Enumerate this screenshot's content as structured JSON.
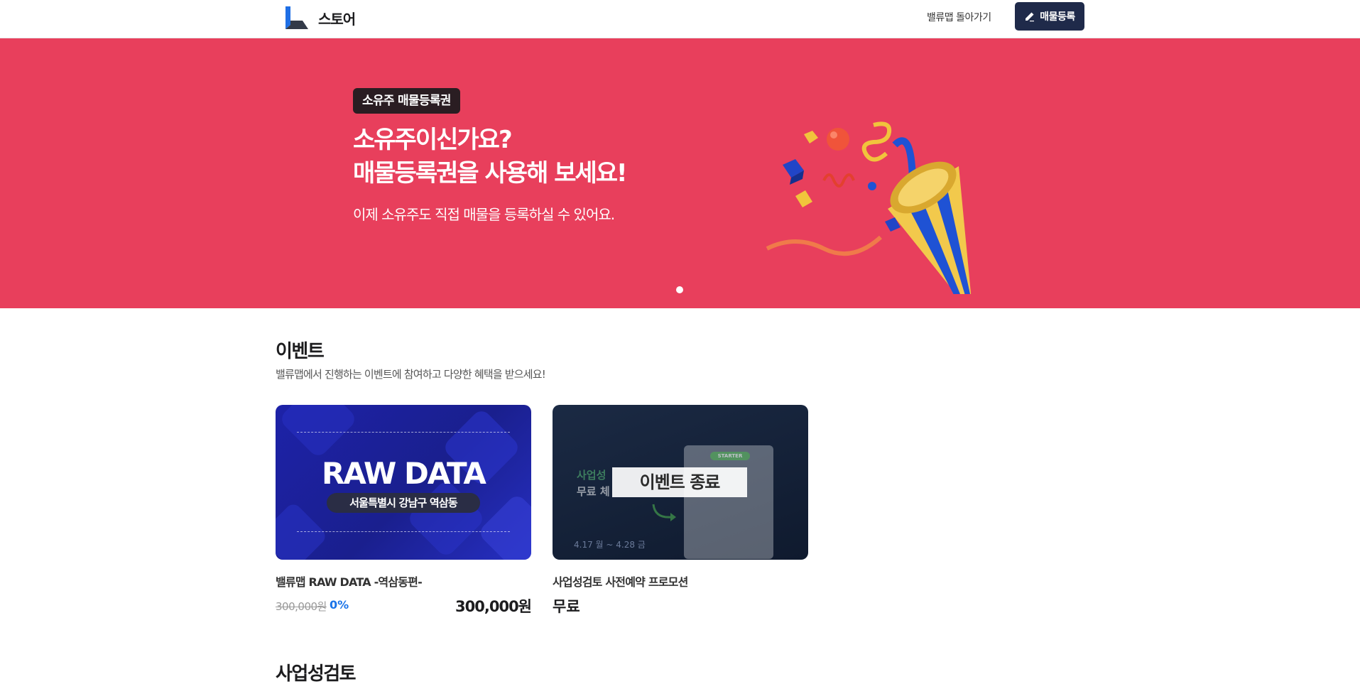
{
  "header": {
    "brand": "스토어",
    "back_link": "밸류맵 돌아가기",
    "register_label": "매물등록"
  },
  "banner": {
    "tag": "소유주 매물등록권",
    "title_line1": "소유주이신가요?",
    "title_line2": "매물등록권을 사용해 보세요!",
    "subtitle": "이제 소유주도 직접 매물을 등록하실 수 있어요.",
    "background_color": "#e83f5c"
  },
  "events": {
    "title": "이벤트",
    "subtitle": "밸류맵에서 진행하는 이벤트에 참여하고 다양한 혜택을 받으세요!",
    "cards": [
      {
        "thumb_title": "RAW DATA",
        "thumb_location": "서울특별시 강남구 역삼동",
        "title": "밸류맵 RAW DATA -역삼동편-",
        "old_price": "300,000원",
        "discount": "0%",
        "price": "300,000원"
      },
      {
        "thumb_badge": "이벤트 종료",
        "thumb_line1": "사업성",
        "thumb_line2": "무료 체",
        "thumb_date": "4.17 월 ~ 4.28 금",
        "thumb_starter": "STARTER",
        "title": "사업성검토 사전예약 프로모션",
        "price": "무료"
      }
    ]
  },
  "next_section": {
    "title": "사업성검토"
  },
  "colors": {
    "accent_dark": "#1f2a4a",
    "discount_blue": "#1a73e8"
  }
}
